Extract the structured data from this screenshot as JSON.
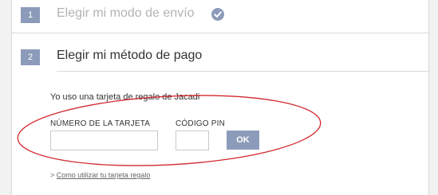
{
  "steps": [
    {
      "number": "1",
      "title": "Elegir mi modo de envío",
      "completed_icon": "check-circle-icon"
    },
    {
      "number": "2",
      "title": "Elegir mi método de pago"
    }
  ],
  "gift_card": {
    "intro": "Yo uso una tarjeta de regalo de Jacadi",
    "card_number_label": "NÚMERO DE LA TARJETA",
    "card_number_value": "",
    "pin_label": "CÓDIGO PIN",
    "pin_value": "",
    "ok_label": "OK",
    "help_prefix": ">",
    "help_link": "Como utilizar tu tarjeta regalo"
  },
  "colors": {
    "accent": "#8c9bb9",
    "annotation": "#d2282e"
  }
}
